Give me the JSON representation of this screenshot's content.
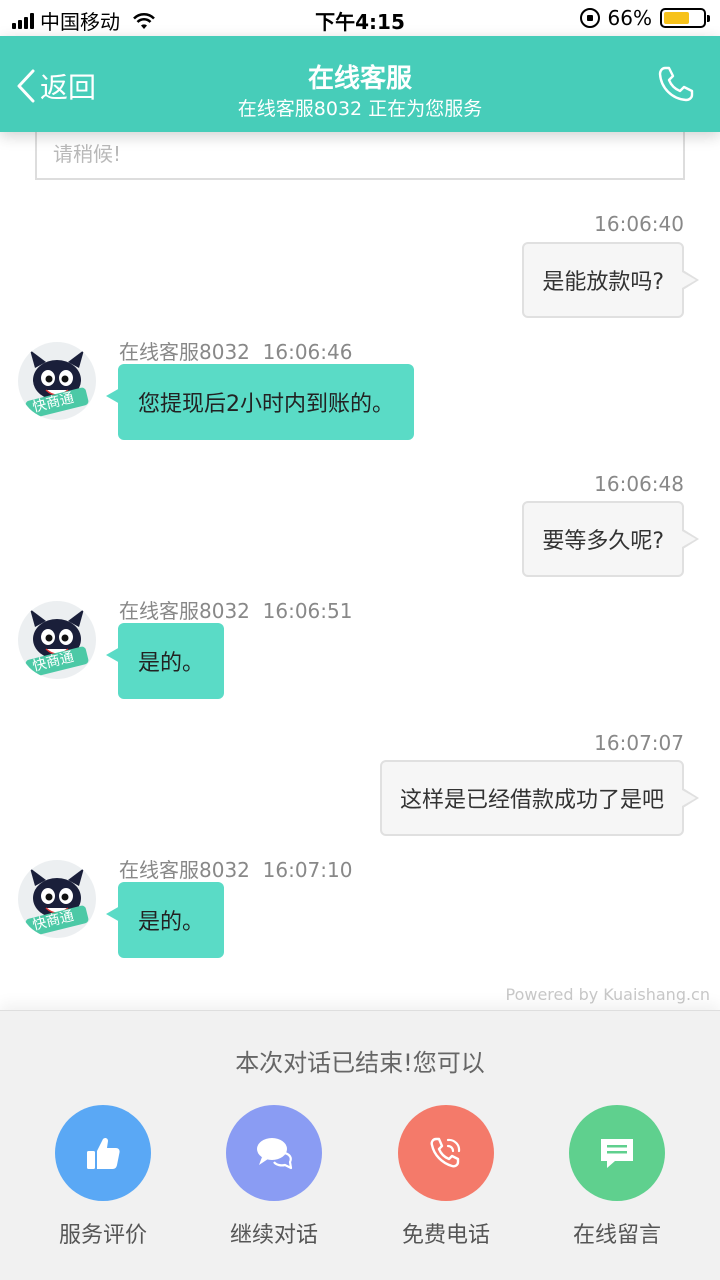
{
  "status_bar": {
    "carrier": "中国移动",
    "time": "下午4:15",
    "battery": "66%",
    "battery_level": 0.66
  },
  "header": {
    "back_label": "返回",
    "title": "在线客服",
    "subtitle": "在线客服8032 正在为您服务"
  },
  "wait_placeholder": "请稍候!",
  "messages": [
    {
      "time": "16:06:40",
      "text": "是能放款吗?"
    },
    {
      "agent": "在线客服8032",
      "time": "16:06:46",
      "text": "您提现后2小时内到账的。"
    },
    {
      "time": "16:06:48",
      "text": "要等多久呢?"
    },
    {
      "agent": "在线客服8032",
      "time": "16:06:51",
      "text": "是的。"
    },
    {
      "time": "16:07:07",
      "text": "这样是已经借款成功了是吧"
    },
    {
      "agent": "在线客服8032",
      "time": "16:07:10",
      "text": "是的。"
    }
  ],
  "avatar_text": "快商通",
  "powered_by": "Powered by Kuaishang.cn",
  "panel": {
    "message": "本次对话已结束!您可以",
    "actions": [
      {
        "label": "服务评价",
        "icon": "thumbs-up-icon",
        "color": "#5aa8f5"
      },
      {
        "label": "继续对话",
        "icon": "chat-bubbles-icon",
        "color": "#8a9cf3"
      },
      {
        "label": "免费电话",
        "icon": "phone-icon",
        "color": "#f47a6a"
      },
      {
        "label": "在线留言",
        "icon": "message-icon",
        "color": "#5fd08e"
      }
    ]
  },
  "colors": {
    "header": "#47cdb9",
    "agent_bubble": "#5adbc6",
    "user_bubble": "#f6f6f6"
  }
}
